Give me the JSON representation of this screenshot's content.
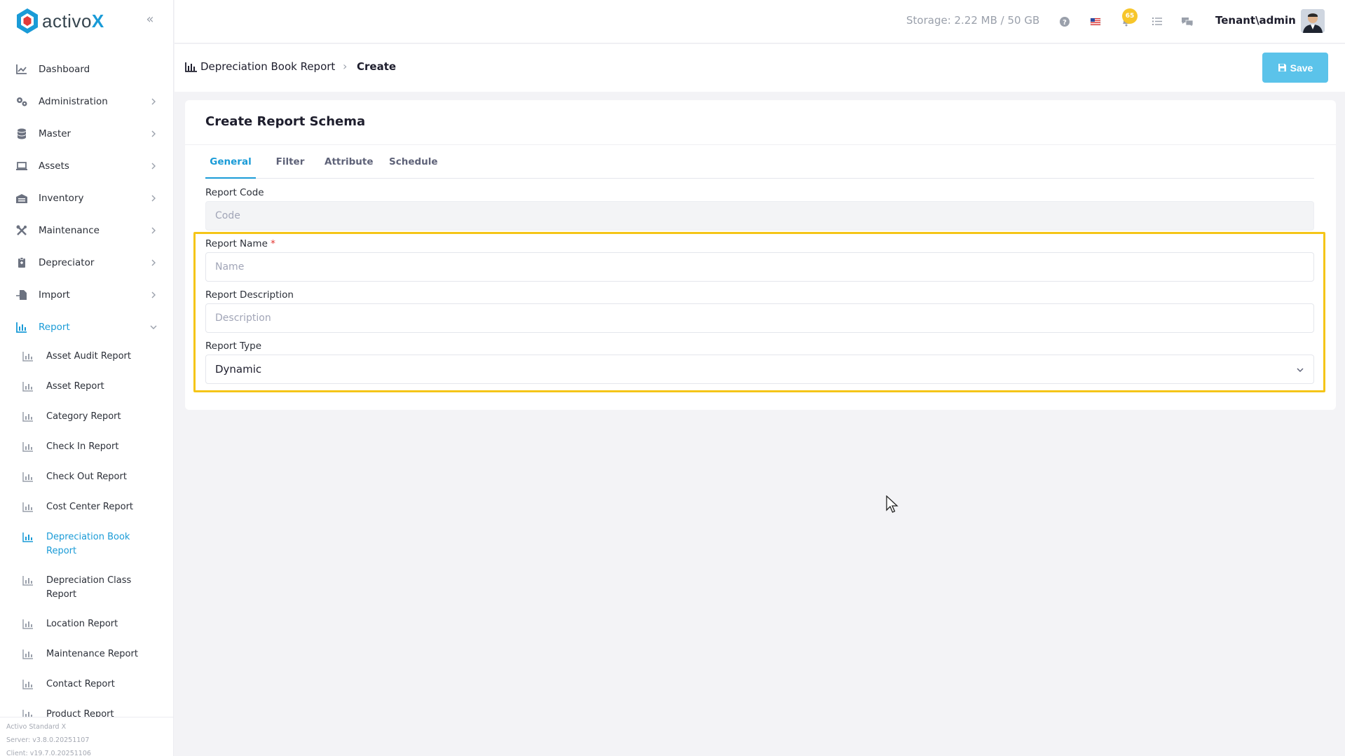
{
  "app": {
    "logo_text": "activo",
    "logo_x": "X",
    "brand_color": "#1a9bd7"
  },
  "sidebar": {
    "items": [
      {
        "label": "Dashboard",
        "icon": "chart-line-icon"
      },
      {
        "label": "Administration",
        "icon": "gears-icon"
      },
      {
        "label": "Master",
        "icon": "database-icon"
      },
      {
        "label": "Assets",
        "icon": "laptop-icon"
      },
      {
        "label": "Inventory",
        "icon": "warehouse-icon"
      },
      {
        "label": "Maintenance",
        "icon": "tools-icon"
      },
      {
        "label": "Depreciator",
        "icon": "clipboard-icon"
      },
      {
        "label": "Import",
        "icon": "file-import-icon"
      },
      {
        "label": "Report",
        "icon": "bar-chart-icon"
      }
    ],
    "report_items": [
      "Asset Audit Report",
      "Asset Report",
      "Category Report",
      "Check In Report",
      "Check Out Report",
      "Cost Center Report",
      "Depreciation Book Report",
      "Depreciation Class Report",
      "Location Report",
      "Maintenance Report",
      "Contact Report",
      "Product Report"
    ],
    "footer": {
      "product": "Activo Standard X",
      "server": "Server: v3.8.0.20251107",
      "client": "Client: v19.7.0.20251106"
    }
  },
  "topbar": {
    "storage": "Storage: 2.22 MB / 50 GB",
    "notification_count": "65",
    "user": "Tenant\\admin"
  },
  "header": {
    "breadcrumb_parent": "Depreciation Book Report",
    "breadcrumb_current": "Create",
    "save_label": "Save"
  },
  "form": {
    "title": "Create Report Schema",
    "tabs": [
      "General",
      "Filter",
      "Attribute",
      "Schedule"
    ],
    "report_code_label": "Report Code",
    "report_code_placeholder": "Code",
    "report_name_label": "Report Name",
    "required_mark": "*",
    "report_name_placeholder": "Name",
    "report_description_label": "Report Description",
    "report_description_placeholder": "Description",
    "report_type_label": "Report Type",
    "report_type_value": "Dynamic"
  },
  "colors": {
    "accent": "#1a9bd7",
    "save_button": "#5bc3ea",
    "highlight": "#f5c518",
    "required": "#e3342f"
  }
}
